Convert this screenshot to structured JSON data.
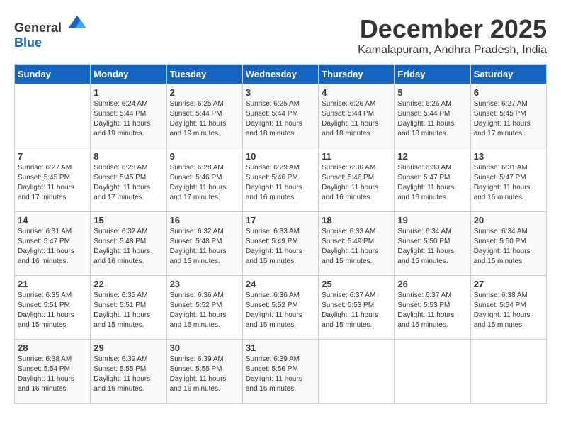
{
  "logo": {
    "general": "General",
    "blue": "Blue"
  },
  "title": {
    "month": "December 2025",
    "location": "Kamalapuram, Andhra Pradesh, India"
  },
  "headers": [
    "Sunday",
    "Monday",
    "Tuesday",
    "Wednesday",
    "Thursday",
    "Friday",
    "Saturday"
  ],
  "weeks": [
    [
      {
        "day": "",
        "sunrise": "",
        "sunset": "",
        "daylight": ""
      },
      {
        "day": "1",
        "sunrise": "Sunrise: 6:24 AM",
        "sunset": "Sunset: 5:44 PM",
        "daylight": "Daylight: 11 hours and 19 minutes."
      },
      {
        "day": "2",
        "sunrise": "Sunrise: 6:25 AM",
        "sunset": "Sunset: 5:44 PM",
        "daylight": "Daylight: 11 hours and 19 minutes."
      },
      {
        "day": "3",
        "sunrise": "Sunrise: 6:25 AM",
        "sunset": "Sunset: 5:44 PM",
        "daylight": "Daylight: 11 hours and 18 minutes."
      },
      {
        "day": "4",
        "sunrise": "Sunrise: 6:26 AM",
        "sunset": "Sunset: 5:44 PM",
        "daylight": "Daylight: 11 hours and 18 minutes."
      },
      {
        "day": "5",
        "sunrise": "Sunrise: 6:26 AM",
        "sunset": "Sunset: 5:44 PM",
        "daylight": "Daylight: 11 hours and 18 minutes."
      },
      {
        "day": "6",
        "sunrise": "Sunrise: 6:27 AM",
        "sunset": "Sunset: 5:45 PM",
        "daylight": "Daylight: 11 hours and 17 minutes."
      }
    ],
    [
      {
        "day": "7",
        "sunrise": "Sunrise: 6:27 AM",
        "sunset": "Sunset: 5:45 PM",
        "daylight": "Daylight: 11 hours and 17 minutes."
      },
      {
        "day": "8",
        "sunrise": "Sunrise: 6:28 AM",
        "sunset": "Sunset: 5:45 PM",
        "daylight": "Daylight: 11 hours and 17 minutes."
      },
      {
        "day": "9",
        "sunrise": "Sunrise: 6:28 AM",
        "sunset": "Sunset: 5:46 PM",
        "daylight": "Daylight: 11 hours and 17 minutes."
      },
      {
        "day": "10",
        "sunrise": "Sunrise: 6:29 AM",
        "sunset": "Sunset: 5:46 PM",
        "daylight": "Daylight: 11 hours and 16 minutes."
      },
      {
        "day": "11",
        "sunrise": "Sunrise: 6:30 AM",
        "sunset": "Sunset: 5:46 PM",
        "daylight": "Daylight: 11 hours and 16 minutes."
      },
      {
        "day": "12",
        "sunrise": "Sunrise: 6:30 AM",
        "sunset": "Sunset: 5:47 PM",
        "daylight": "Daylight: 11 hours and 16 minutes."
      },
      {
        "day": "13",
        "sunrise": "Sunrise: 6:31 AM",
        "sunset": "Sunset: 5:47 PM",
        "daylight": "Daylight: 11 hours and 16 minutes."
      }
    ],
    [
      {
        "day": "14",
        "sunrise": "Sunrise: 6:31 AM",
        "sunset": "Sunset: 5:47 PM",
        "daylight": "Daylight: 11 hours and 16 minutes."
      },
      {
        "day": "15",
        "sunrise": "Sunrise: 6:32 AM",
        "sunset": "Sunset: 5:48 PM",
        "daylight": "Daylight: 11 hours and 16 minutes."
      },
      {
        "day": "16",
        "sunrise": "Sunrise: 6:32 AM",
        "sunset": "Sunset: 5:48 PM",
        "daylight": "Daylight: 11 hours and 15 minutes."
      },
      {
        "day": "17",
        "sunrise": "Sunrise: 6:33 AM",
        "sunset": "Sunset: 5:49 PM",
        "daylight": "Daylight: 11 hours and 15 minutes."
      },
      {
        "day": "18",
        "sunrise": "Sunrise: 6:33 AM",
        "sunset": "Sunset: 5:49 PM",
        "daylight": "Daylight: 11 hours and 15 minutes."
      },
      {
        "day": "19",
        "sunrise": "Sunrise: 6:34 AM",
        "sunset": "Sunset: 5:50 PM",
        "daylight": "Daylight: 11 hours and 15 minutes."
      },
      {
        "day": "20",
        "sunrise": "Sunrise: 6:34 AM",
        "sunset": "Sunset: 5:50 PM",
        "daylight": "Daylight: 11 hours and 15 minutes."
      }
    ],
    [
      {
        "day": "21",
        "sunrise": "Sunrise: 6:35 AM",
        "sunset": "Sunset: 5:51 PM",
        "daylight": "Daylight: 11 hours and 15 minutes."
      },
      {
        "day": "22",
        "sunrise": "Sunrise: 6:35 AM",
        "sunset": "Sunset: 5:51 PM",
        "daylight": "Daylight: 11 hours and 15 minutes."
      },
      {
        "day": "23",
        "sunrise": "Sunrise: 6:36 AM",
        "sunset": "Sunset: 5:52 PM",
        "daylight": "Daylight: 11 hours and 15 minutes."
      },
      {
        "day": "24",
        "sunrise": "Sunrise: 6:36 AM",
        "sunset": "Sunset: 5:52 PM",
        "daylight": "Daylight: 11 hours and 15 minutes."
      },
      {
        "day": "25",
        "sunrise": "Sunrise: 6:37 AM",
        "sunset": "Sunset: 5:53 PM",
        "daylight": "Daylight: 11 hours and 15 minutes."
      },
      {
        "day": "26",
        "sunrise": "Sunrise: 6:37 AM",
        "sunset": "Sunset: 5:53 PM",
        "daylight": "Daylight: 11 hours and 15 minutes."
      },
      {
        "day": "27",
        "sunrise": "Sunrise: 6:38 AM",
        "sunset": "Sunset: 5:54 PM",
        "daylight": "Daylight: 11 hours and 15 minutes."
      }
    ],
    [
      {
        "day": "28",
        "sunrise": "Sunrise: 6:38 AM",
        "sunset": "Sunset: 5:54 PM",
        "daylight": "Daylight: 11 hours and 16 minutes."
      },
      {
        "day": "29",
        "sunrise": "Sunrise: 6:39 AM",
        "sunset": "Sunset: 5:55 PM",
        "daylight": "Daylight: 11 hours and 16 minutes."
      },
      {
        "day": "30",
        "sunrise": "Sunrise: 6:39 AM",
        "sunset": "Sunset: 5:55 PM",
        "daylight": "Daylight: 11 hours and 16 minutes."
      },
      {
        "day": "31",
        "sunrise": "Sunrise: 6:39 AM",
        "sunset": "Sunset: 5:56 PM",
        "daylight": "Daylight: 11 hours and 16 minutes."
      },
      {
        "day": "",
        "sunrise": "",
        "sunset": "",
        "daylight": ""
      },
      {
        "day": "",
        "sunrise": "",
        "sunset": "",
        "daylight": ""
      },
      {
        "day": "",
        "sunrise": "",
        "sunset": "",
        "daylight": ""
      }
    ]
  ]
}
